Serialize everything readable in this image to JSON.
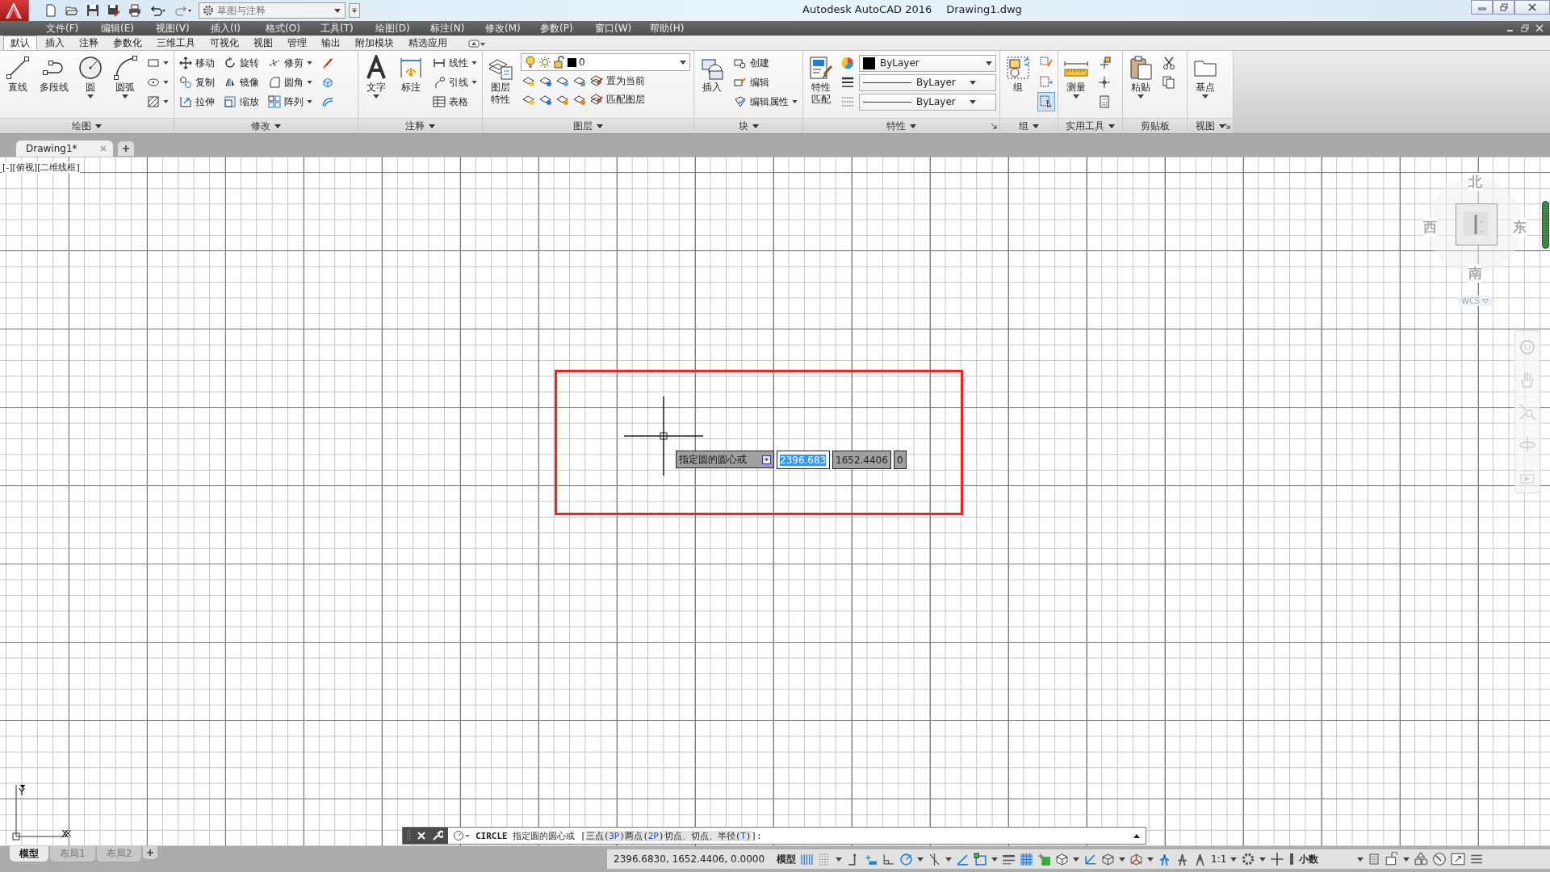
{
  "title_bar": {
    "workspace": "草图与注释",
    "title": "Autodesk AutoCAD 2016",
    "document": "Drawing1.dwg"
  },
  "menu_bar": [
    "文件(F)",
    "编辑(E)",
    "视图(V)",
    "插入(I)",
    "格式(O)",
    "工具(T)",
    "绘图(D)",
    "标注(N)",
    "修改(M)",
    "参数(P)",
    "窗口(W)",
    "帮助(H)"
  ],
  "ribbon_tabs": [
    {
      "label": "默认",
      "selected": true
    },
    {
      "label": "插入",
      "selected": false
    },
    {
      "label": "注释",
      "selected": false
    },
    {
      "label": "参数化",
      "selected": false
    },
    {
      "label": "三维工具",
      "selected": false
    },
    {
      "label": "可视化",
      "selected": false
    },
    {
      "label": "视图",
      "selected": false
    },
    {
      "label": "管理",
      "selected": false
    },
    {
      "label": "输出",
      "selected": false
    },
    {
      "label": "附加模块",
      "selected": false
    },
    {
      "label": "精选应用",
      "selected": false
    }
  ],
  "ribbon_panels": [
    {
      "title": "绘图",
      "menu": true,
      "launcher": false,
      "columns": [
        {
          "kind": "large",
          "label": "直线",
          "dropdown": false
        },
        {
          "kind": "large",
          "label": "多段线",
          "dropdown": false
        },
        {
          "kind": "large",
          "label": "圆",
          "dropdown": true
        },
        {
          "kind": "large",
          "label": "圆弧",
          "dropdown": true
        },
        {
          "kind": "stack",
          "items": [
            {
              "dropdown": true
            },
            {
              "dropdown": true
            },
            {
              "dropdown": true
            }
          ]
        }
      ]
    },
    {
      "title": "修改",
      "menu": true,
      "launcher": false,
      "columns": [
        {
          "kind": "stack",
          "items": [
            {
              "label": "移动",
              "dropdown": false
            },
            {
              "label": "复制",
              "dropdown": false
            },
            {
              "label": "拉伸",
              "dropdown": false
            }
          ]
        },
        {
          "kind": "stack",
          "items": [
            {
              "label": "旋转",
              "dropdown": false
            },
            {
              "label": "镜像",
              "dropdown": false
            },
            {
              "label": "缩放",
              "dropdown": false
            }
          ]
        },
        {
          "kind": "stack",
          "items": [
            {
              "label": "修剪",
              "dropdown": true
            },
            {
              "label": "圆角",
              "dropdown": true
            },
            {
              "label": "阵列",
              "dropdown": true
            }
          ]
        },
        {
          "kind": "stack",
          "items": [
            {
              "dropdown": false
            },
            {
              "dropdown": false
            },
            {
              "dropdown": false
            }
          ]
        }
      ]
    },
    {
      "title": "注释",
      "menu": true,
      "launcher": false,
      "columns": [
        {
          "kind": "large",
          "label": "文字",
          "dropdown": true
        },
        {
          "kind": "large",
          "label": "标注",
          "dropdown": false
        },
        {
          "kind": "stack",
          "items": [
            {
              "label": "线性",
              "dropdown": true
            },
            {
              "label": "引线",
              "dropdown": true
            },
            {
              "label": "表格",
              "dropdown": false
            }
          ]
        }
      ]
    },
    {
      "title": "图层",
      "menu": true,
      "launcher": false,
      "columns": [
        {
          "kind": "large",
          "label": "图层特性",
          "dropdown": false
        },
        {
          "kind": "layers",
          "value": "0",
          "rows": [
            {
              "label": "置为当前"
            },
            {
              "label": "匹配图层"
            }
          ]
        }
      ]
    },
    {
      "title": "块",
      "menu": true,
      "launcher": false,
      "columns": [
        {
          "kind": "large",
          "label": "插入",
          "dropdown": false
        },
        {
          "kind": "stack",
          "items": [
            {
              "label": "创建",
              "dropdown": false
            },
            {
              "label": "编辑",
              "dropdown": false
            },
            {
              "label": "编辑属性",
              "dropdown": true
            }
          ]
        }
      ]
    },
    {
      "title": "特性",
      "menu": true,
      "launcher": true,
      "columns": [
        {
          "kind": "large",
          "label": "特性匹配",
          "dropdown": false
        },
        {
          "kind": "combos",
          "items": [
            {
              "value": "ByLayer"
            },
            {
              "value": "ByLayer"
            },
            {
              "value": "ByLayer"
            }
          ]
        }
      ]
    },
    {
      "title": "组",
      "menu": true,
      "launcher": false,
      "columns": [
        {
          "kind": "large",
          "label": "组",
          "dropdown": false
        },
        {
          "kind": "stack",
          "items": [
            {
              "dropdown": false,
              "on": false
            },
            {
              "dropdown": false,
              "on": false
            },
            {
              "dropdown": false,
              "on": true
            }
          ]
        }
      ]
    },
    {
      "title": "实用工具",
      "menu": true,
      "launcher": false,
      "columns": [
        {
          "kind": "large",
          "label": "测量",
          "dropdown": true
        },
        {
          "kind": "stack",
          "items": [
            {
              "dropdown": false
            },
            {
              "dropdown": false
            },
            {
              "dropdown": false
            }
          ]
        }
      ]
    },
    {
      "title": "剪贴板",
      "menu": false,
      "launcher": false,
      "columns": [
        {
          "kind": "large",
          "label": "粘贴",
          "dropdown": true
        },
        {
          "kind": "stack",
          "items": [
            {
              "dropdown": false
            },
            {
              "dropdown": false
            }
          ]
        }
      ]
    },
    {
      "title": "视图",
      "menu": true,
      "launcher": true,
      "columns": [
        {
          "kind": "large",
          "label": "基点",
          "dropdown": true
        }
      ]
    }
  ],
  "file_tabs": [
    {
      "label": "Drawing1*",
      "selected": true
    }
  ],
  "viewport_label": "[-][俯视][二维线框]",
  "viewcube": {
    "north": "北",
    "west": "西",
    "east": "东",
    "south": "南",
    "ucs": "WCS"
  },
  "ucs_icon": {
    "x": "X",
    "y": "Y"
  },
  "dynamic_input": {
    "prompt": "指定圆的圆心或",
    "fields": [
      {
        "value": "2396.683",
        "selected": true
      },
      {
        "value": "1652.4406",
        "selected": false
      },
      {
        "value": "0",
        "selected": false
      }
    ]
  },
  "command_line": {
    "command": "CIRCLE",
    "prompt": "指定圆的圆心或 [",
    "options": [
      {
        "before": "三点(",
        "key": "3P",
        "after": ")"
      },
      {
        "before": "两点(",
        "key": "2P",
        "after": ")"
      },
      {
        "before": "切点、切点、半径(",
        "key": "T",
        "after": ")"
      }
    ],
    "end": "]:"
  },
  "layout_tabs": [
    {
      "label": "模型",
      "selected": true
    },
    {
      "label": "布局1",
      "selected": false
    },
    {
      "label": "布局2",
      "selected": false
    }
  ],
  "status_bar": {
    "coordinates": "2396.6830, 1652.4406, 0.0000",
    "space": "模型",
    "toggles": [
      {
        "kind": "toggle",
        "on": true
      },
      {
        "kind": "toggle",
        "on": false
      },
      {
        "kind": "menu"
      },
      {
        "kind": "toggle",
        "on": false
      },
      {
        "kind": "toggle",
        "on": true
      },
      {
        "kind": "toggle",
        "on": false
      },
      {
        "kind": "toggle",
        "on": true
      },
      {
        "kind": "menu"
      },
      {
        "kind": "toggle",
        "on": false
      },
      {
        "kind": "menu"
      },
      {
        "kind": "toggle",
        "on": true
      },
      {
        "kind": "toggle",
        "on": true
      },
      {
        "kind": "menu"
      },
      {
        "kind": "toggle",
        "on": false
      },
      {
        "kind": "toggle",
        "on": true
      },
      {
        "kind": "toggle",
        "on": false
      },
      {
        "kind": "toggle",
        "on": false
      },
      {
        "kind": "menu"
      },
      {
        "kind": "toggle",
        "on": true
      },
      {
        "kind": "toggle",
        "on": false
      },
      {
        "kind": "menu"
      },
      {
        "kind": "toggle",
        "on": false
      },
      {
        "kind": "menu"
      },
      {
        "kind": "toggle",
        "on": true
      },
      {
        "kind": "toggle",
        "on": false
      },
      {
        "kind": "toggle",
        "on": false
      }
    ],
    "scale": "1:1",
    "units": "小数"
  }
}
